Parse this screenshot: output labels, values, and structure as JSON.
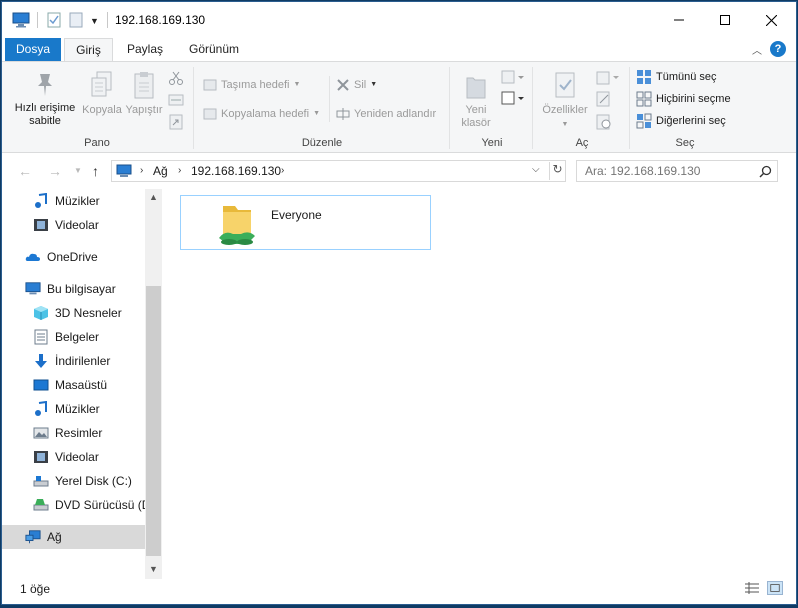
{
  "window": {
    "title": "192.168.169.130"
  },
  "ribbon_tabs": [
    "Dosya",
    "Giriş",
    "Paylaş",
    "Görünüm"
  ],
  "ribbon": {
    "pano": {
      "label": "Pano",
      "pin": "Hızlı erişime sabitle",
      "pin_line1": "Hızlı erişime",
      "pin_line2": "sabitle",
      "copy": "Kopyala",
      "paste": "Yapıştır"
    },
    "duzenle": {
      "label": "Düzenle",
      "move_to": "Taşıma hedefi",
      "copy_to": "Kopyalama hedefi",
      "delete": "Sil",
      "rename": "Yeniden adlandır"
    },
    "yeni": {
      "label": "Yeni",
      "new_folder_line1": "Yeni",
      "new_folder_line2": "klasör"
    },
    "ac": {
      "label": "Aç",
      "properties": "Özellikler"
    },
    "sec": {
      "label": "Seç",
      "select_all": "Tümünü seç",
      "select_none": "Hiçbirini seçme",
      "invert": "Diğerlerini seç"
    }
  },
  "address": {
    "crumbs": [
      "Ağ",
      "192.168.169.130"
    ]
  },
  "search": {
    "placeholder": "Ara: 192.168.169.130"
  },
  "sidebar": {
    "items": [
      {
        "label": "Müzikler",
        "icon": "music-icon"
      },
      {
        "label": "Videolar",
        "icon": "video-icon"
      },
      {
        "label": "OneDrive",
        "icon": "cloud-icon"
      },
      {
        "label": "Bu bilgisayar",
        "icon": "computer-icon"
      },
      {
        "label": "3D Nesneler",
        "icon": "cube-icon"
      },
      {
        "label": "Belgeler",
        "icon": "document-icon"
      },
      {
        "label": "İndirilenler",
        "icon": "download-icon"
      },
      {
        "label": "Masaüstü",
        "icon": "desktop-icon"
      },
      {
        "label": "Müzikler",
        "icon": "music-icon"
      },
      {
        "label": "Resimler",
        "icon": "pictures-icon"
      },
      {
        "label": "Videolar",
        "icon": "video-icon"
      },
      {
        "label": "Yerel Disk (C:)",
        "icon": "drive-icon"
      },
      {
        "label": "DVD Sürücüsü (D",
        "icon": "dvd-icon"
      },
      {
        "label": "Ağ",
        "icon": "network-icon"
      }
    ]
  },
  "content": {
    "items": [
      {
        "label": "Everyone",
        "icon": "shared-folder-icon"
      }
    ]
  },
  "status": {
    "count": "1 öğe"
  },
  "colors": {
    "accent": "#1979ca",
    "selection": "#cce8ff",
    "tile_border": "#99d1ff"
  }
}
